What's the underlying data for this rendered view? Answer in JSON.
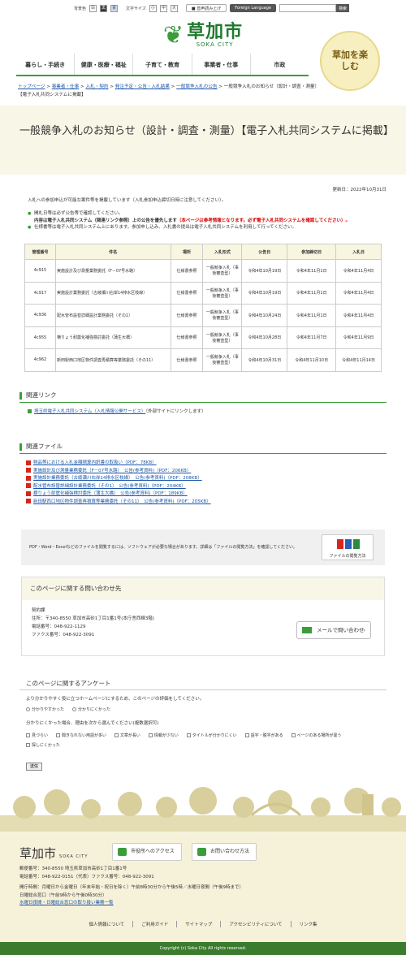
{
  "header": {
    "bg_label": "背景色",
    "bg_options": [
      "白",
      "黒",
      "青"
    ],
    "fontsize_label": "文字サイズ",
    "fontsize_options": [
      "小",
      "中",
      "大"
    ],
    "voice": "音声読み上げ",
    "foreign": "Foreign Language",
    "search_button": "検索",
    "site_name": "草加市",
    "site_name_en": "SOKA CITY",
    "badge_text": "草加を楽しむ"
  },
  "gnav": [
    "暮らし・手続き",
    "健康・医療・福祉",
    "子育て・教育",
    "事業者・仕事",
    "市政"
  ],
  "breadcrumb": [
    "トップページ",
    "事業者・仕事",
    "入札・契約",
    "発注予定・公告・入札結果",
    "一般競争入札の公告",
    "一般競争入札のお知らせ（設計・調査・測量）【電子入札共同システムに掲載】"
  ],
  "page_title": "一般競争入札のお知らせ（設計・調査・測量）【電子入札共同システムに掲載】",
  "updated": "更新日：2022年10月31日",
  "intro": "入札への参加申込が可能な案件等を掲載しています（入札参加申込締切日時に注意してください）。",
  "notes": {
    "n1a": "開札日等は必ず公告等で確認してください。",
    "n1b": "内容は電子入札共同システム（関連リンク参照）上の公告を優先します",
    "n1c": "（本ページは参考情報となります。必ず電子入札共同システムを確認してください）。",
    "n2": "仕様書等は電子入札共同システム上にあります。参加申し込み、入札書の提出は電子入札共同システムを利用して行ってください。"
  },
  "table": {
    "headers": [
      "管理番号",
      "件名",
      "場所",
      "入札形式",
      "公告日",
      "参加締切日",
      "入札日"
    ],
    "rows": [
      [
        "4c915",
        "実施設計及び測量業務委託（F－07号水路）",
        "仕様書参照",
        "一般競争入札（事後審査型）",
        "令和4年10月19日",
        "令和4年11月1日",
        "令和4年11月4日"
      ],
      [
        "4c917",
        "実施設計業務委託（古綾瀬川右岸14排水区枝線）",
        "仕様書参照",
        "一般競争入札（事後審査型）",
        "令和4年10月19日",
        "令和4年11月1日",
        "令和4年11月4日"
      ],
      [
        "4c936",
        "配水管布設替詳細設計業務委託（その1）",
        "仕様書参照",
        "一般競争入札（事後審査型）",
        "令和4年10月24日",
        "令和4年11月1日",
        "令和4年11月4日"
      ],
      [
        "4c955",
        "横りょう耐震化補強検討委託（蒲生大橋）",
        "仕様書参照",
        "一般競争入札（事後審査型）",
        "令和4年10月28日",
        "令和4年11月7日",
        "令和4年11月9日"
      ],
      [
        "4c962",
        "新田駅西口地区物件調査再積算等業務委託（その11）",
        "仕様書参照",
        "一般競争入札（事後審査型）",
        "令和4年10月31日",
        "令和4年11月10日",
        "令和4年11月14日"
      ]
    ]
  },
  "related_links": {
    "heading": "関連リンク",
    "link": "埼玉県電子入札共同システム（入札情報公開サービス）",
    "note": "（外部サイトにリンクします）"
  },
  "related_files": {
    "heading": "関連ファイル",
    "files": [
      "物品等における入札金額積算内訳書の取扱い（PDF：78KB）",
      "実施設計及び測量業務委託（F－07号水路）　公告(参考資料)（PDF：206KB）",
      "実施設計業務委託（古綾瀬川右岸14排水区枝線）　公告(参考資料)（PDF：208KB）",
      "配水管布設替詳細設計業務委託（その1）　公告(参考資料)（PDF：204KB）",
      "横りょう耐震化補強検討委託（蒲生大橋）　公告(参考資料)（PDF：189KB）",
      "新田駅西口地区物件調査再積算等業務委託（その11）　公告(参考資料)（PDF：205KB）"
    ]
  },
  "pdf_notice": "PDF・Word・Excelなどのファイルを閲覧するには、ソフトウェアが必要な場合があります。詳細は「ファイルの閲覧方法」を確認してください。",
  "pdf_button": "ファイルの閲覧方法",
  "inquiry": {
    "heading": "このページに関する問い合わせ先",
    "dept": "契約課",
    "address": "住所：〒340-8550 草加市高砂1丁目1番1号(本庁舎西棟3階)",
    "tel": "電話番号：048-922-1129",
    "fax": "ファクス番号：048-922-3091",
    "mail_button": "メールで問い合わせ"
  },
  "survey": {
    "heading": "このページに関するアンケート",
    "q1": "より分かりやすく役に立つホームページにするため、このページの評価をしてください。",
    "q1_options": [
      "分かりやすかった",
      "分かりにくかった"
    ],
    "q2": "分かりにくかった場合、理由を次から選んでください(複数選択可)",
    "q2_options": [
      "見づらい",
      "聞きなれない用語が多い",
      "文章が長い",
      "情報が少ない",
      "タイトルが分かりにくい",
      "語字・脱字がある",
      "ページのある場所が違う",
      "探しにくかった"
    ],
    "send": "送信"
  },
  "footer": {
    "name": "草加市",
    "name_en": "SOKA CITY",
    "access_button": "市役所へのアクセス",
    "contact_button": "お問い合わせ方法",
    "address": "郵便番号：340-8550 埼玉県草加市高砂1丁目1番1号",
    "tel": "電話番号：048-922-0151（代表）ファクス番号：048-922-3091",
    "hours1": "開庁時間：月曜日から金曜日（年末年始・祝日を除く）午前8時30分から午後5時／水曜日夜間（午後9時まで）",
    "hours2": "日曜総合窓口（午前9時から午後0時30分）",
    "hours_link": "水曜日夜間・日曜総合窓口の取り扱い業務一覧",
    "links": [
      "個人情報について",
      "ご利用ガイド",
      "サイトマップ",
      "アクセシビリティについて",
      "リンク集"
    ],
    "copyright": "Copyright (c) Soka City All rights reserved."
  },
  "colors": {
    "accent": "#3b9d3a",
    "link": "#1a56a8",
    "title_bg": "#f8f6e6",
    "footer_bg": "#f6f2da"
  }
}
